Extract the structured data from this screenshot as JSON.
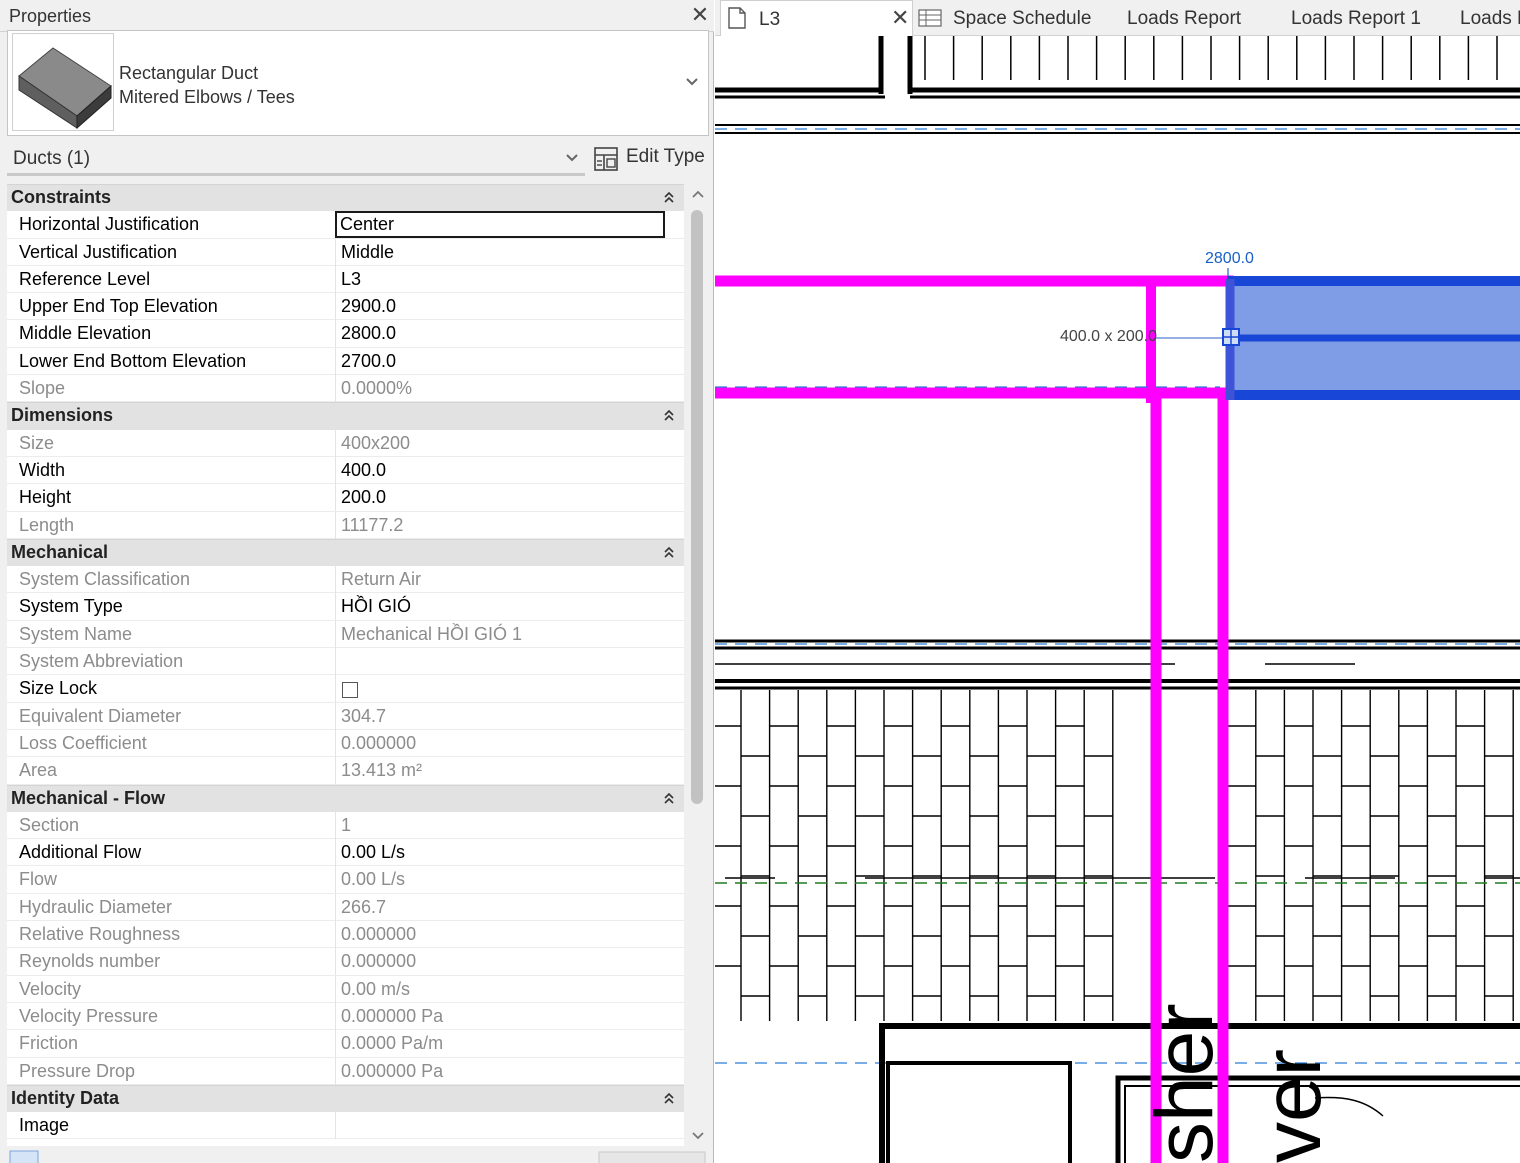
{
  "panel": {
    "title": "Properties",
    "close": "✕",
    "type_selector": {
      "family": "Rectangular Duct",
      "type": "Mitered Elbows / Tees"
    },
    "instance_filter": "Ducts (1)",
    "edit_type": "Edit Type"
  },
  "groups": [
    {
      "name": "Constraints",
      "rows": [
        {
          "name": "Horizontal Justification",
          "value": "Center",
          "editing": true
        },
        {
          "name": "Vertical Justification",
          "value": "Middle"
        },
        {
          "name": "Reference Level",
          "value": "L3"
        },
        {
          "name": "Upper End Top Elevation",
          "value": "2900.0"
        },
        {
          "name": "Middle Elevation",
          "value": "2800.0"
        },
        {
          "name": "Lower End Bottom Elevation",
          "value": "2700.0"
        },
        {
          "name": "Slope",
          "value": "0.0000%",
          "readonly": true
        }
      ]
    },
    {
      "name": "Dimensions",
      "rows": [
        {
          "name": "Size",
          "value": "400x200",
          "readonly": true
        },
        {
          "name": "Width",
          "value": "400.0"
        },
        {
          "name": "Height",
          "value": "200.0"
        },
        {
          "name": "Length",
          "value": "11177.2",
          "readonly": true
        }
      ]
    },
    {
      "name": "Mechanical",
      "rows": [
        {
          "name": "System Classification",
          "value": "Return Air",
          "readonly": true
        },
        {
          "name": "System Type",
          "value": "HỒI GIÓ"
        },
        {
          "name": "System Name",
          "value": "Mechanical HỒI GIÓ 1",
          "readonly": true
        },
        {
          "name": "System Abbreviation",
          "value": "",
          "readonly": true
        },
        {
          "name": "Size Lock",
          "value": "",
          "checkbox": true
        },
        {
          "name": "Equivalent Diameter",
          "value": "304.7",
          "readonly": true
        },
        {
          "name": "Loss Coefficient",
          "value": "0.000000",
          "readonly": true
        },
        {
          "name": "Area",
          "value": "13.413 m²",
          "readonly": true
        }
      ]
    },
    {
      "name": "Mechanical - Flow",
      "rows": [
        {
          "name": "Section",
          "value": "1",
          "readonly": true
        },
        {
          "name": "Additional Flow",
          "value": "0.00 L/s"
        },
        {
          "name": "Flow",
          "value": "0.00 L/s",
          "readonly": true
        },
        {
          "name": "Hydraulic Diameter",
          "value": "266.7",
          "readonly": true
        },
        {
          "name": "Relative Roughness",
          "value": "0.000000",
          "readonly": true
        },
        {
          "name": "Reynolds number",
          "value": "0.000000",
          "readonly": true
        },
        {
          "name": "Velocity",
          "value": "0.00 m/s",
          "readonly": true
        },
        {
          "name": "Velocity Pressure",
          "value": "0.000000 Pa",
          "readonly": true
        },
        {
          "name": "Friction",
          "value": "0.0000 Pa/m",
          "readonly": true
        },
        {
          "name": "Pressure Drop",
          "value": "0.000000 Pa",
          "readonly": true
        }
      ]
    },
    {
      "name": "Identity Data",
      "rows": [
        {
          "name": "Image",
          "value": ""
        }
      ]
    }
  ],
  "tabs": [
    {
      "label": "L3",
      "active": true,
      "close": "✕"
    },
    {
      "label": "Space Schedule"
    },
    {
      "label": "Loads Report"
    },
    {
      "label": "Loads Report 1"
    },
    {
      "label": "Loads R"
    }
  ],
  "view": {
    "dimension_label": "2800.0",
    "size_label": "400.0 x 200.0",
    "text_1": "sher",
    "text_2": "ver"
  },
  "colors": {
    "duct_magenta": "#ff00ff",
    "selected_blue": "#1846d6",
    "selected_fill": "#7f9de6",
    "dimension_blue": "#1a5fc6",
    "group_header": "#e2e2e2"
  }
}
